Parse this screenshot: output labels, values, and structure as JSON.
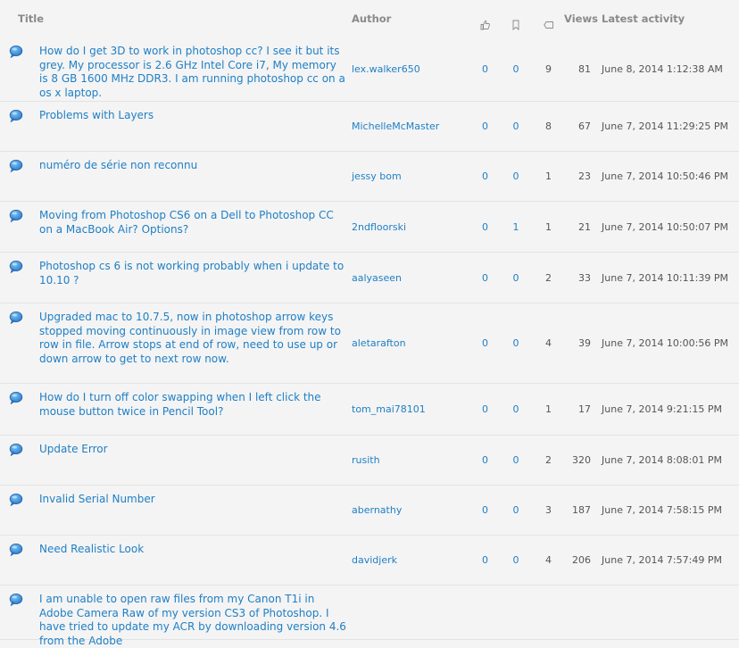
{
  "columns": {
    "title": "Title",
    "author": "Author",
    "likes_icon": "thumbs-up-icon",
    "bookmarks_icon": "bookmark-icon",
    "replies_icon": "tag-icon",
    "views": "Views",
    "activity": "Latest activity"
  },
  "threads": [
    {
      "title": "How do I get 3D to work in photoshop cc? I see it but its grey. My processor is 2.6 GHz Intel Core i7, My memory is 8 GB 1600 MHz DDR3. I am running photoshop cc on a os x laptop.",
      "author": "lex.walker650",
      "likes": "0",
      "bookmarks": "0",
      "replies": "9",
      "views": "81",
      "activity": "June 8, 2014 1:12:38 AM"
    },
    {
      "title": "Problems with Layers",
      "author": "MichelleMcMaster",
      "likes": "0",
      "bookmarks": "0",
      "replies": "8",
      "views": "67",
      "activity": "June 7, 2014 11:29:25 PM"
    },
    {
      "title": "numéro de série non reconnu",
      "author": "jessy bom",
      "likes": "0",
      "bookmarks": "0",
      "replies": "1",
      "views": "23",
      "activity": "June 7, 2014 10:50:46 PM"
    },
    {
      "title": "Moving from Photoshop CS6 on a Dell to Photoshop CC on a MacBook Air? Options?",
      "author": "2ndfloorski",
      "likes": "0",
      "bookmarks": "1",
      "replies": "1",
      "views": "21",
      "activity": "June 7, 2014 10:50:07 PM"
    },
    {
      "title": "Photoshop cs 6 is not working probably when i update to 10.10 ?",
      "author": "aalyaseen",
      "likes": "0",
      "bookmarks": "0",
      "replies": "2",
      "views": "33",
      "activity": "June 7, 2014 10:11:39 PM"
    },
    {
      "title": "Upgraded mac to 10.7.5, now in photoshop arrow keys stopped moving continuously in image view from row to row in file. Arrow stops at end of row, need to use up or down arrow to get to next row now.",
      "author": "aletarafton",
      "likes": "0",
      "bookmarks": "0",
      "replies": "4",
      "views": "39",
      "activity": "June 7, 2014 10:00:56 PM"
    },
    {
      "title": "How do I turn off color swapping when I left click the mouse button twice in Pencil Tool?",
      "author": "tom_mai78101",
      "likes": "0",
      "bookmarks": "0",
      "replies": "1",
      "views": "17",
      "activity": "June 7, 2014 9:21:15 PM"
    },
    {
      "title": "Update Error",
      "author": "rusith",
      "likes": "0",
      "bookmarks": "0",
      "replies": "2",
      "views": "320",
      "activity": "June 7, 2014 8:08:01 PM"
    },
    {
      "title": "Invalid Serial Number",
      "author": "abernathy",
      "likes": "0",
      "bookmarks": "0",
      "replies": "3",
      "views": "187",
      "activity": "June 7, 2014 7:58:15 PM"
    },
    {
      "title": "Need Realistic Look",
      "author": "davidjerk",
      "likes": "0",
      "bookmarks": "0",
      "replies": "4",
      "views": "206",
      "activity": "June 7, 2014 7:57:49 PM"
    },
    {
      "title": "I am unable to open raw files from my Canon T1i in Adobe Camera Raw of my version CS3 of Photoshop.  I have tried to update my ACR by downloading version 4.6 from the Adobe",
      "author": "",
      "likes": "",
      "bookmarks": "",
      "replies": "",
      "views": "",
      "activity": ""
    }
  ]
}
